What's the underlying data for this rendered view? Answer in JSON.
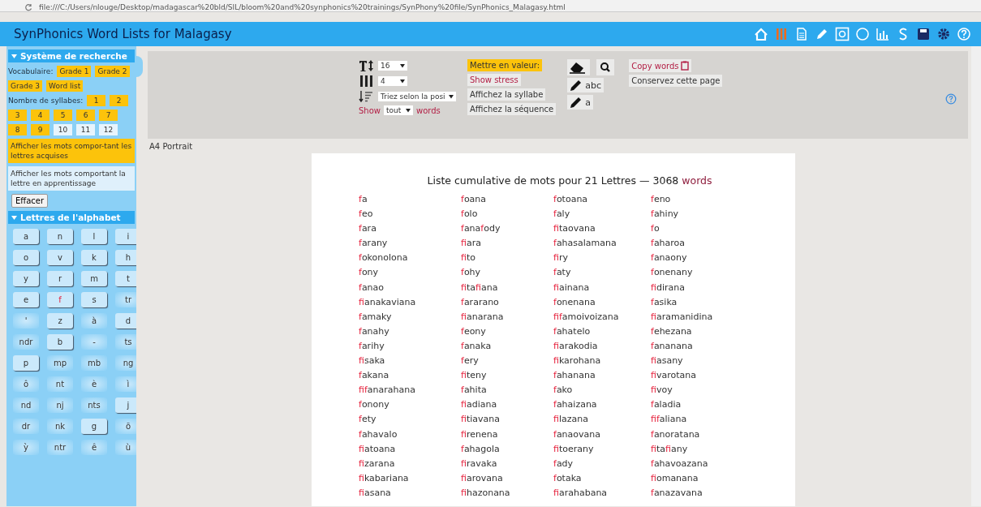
{
  "browser": {
    "url": "file:///C:/Users/nlouge/Desktop/madagascar%20bld/SIL/bloom%20and%20synphonics%20trainings/SynPhony%20file/SynPhonics_Malagasy.html"
  },
  "header": {
    "title": "SynPhonics Word Lists for Malagasy",
    "tools": [
      {
        "kind": "home",
        "selected": false
      },
      {
        "kind": "bars",
        "selected": true
      },
      {
        "kind": "doc",
        "selected": false
      },
      {
        "kind": "pencil",
        "selected": false
      },
      {
        "kind": "boxa",
        "selected": false
      },
      {
        "kind": "circle",
        "selected": false
      },
      {
        "kind": "chart",
        "selected": false
      },
      {
        "kind": "s",
        "selected": false
      },
      {
        "kind": "save",
        "selected": false
      },
      {
        "kind": "gear",
        "selected": false
      },
      {
        "kind": "help",
        "selected": false
      }
    ]
  },
  "sidebar": {
    "search": {
      "title": "Système de recherche",
      "expanded": true,
      "vocab_label": "Vocabulaire:",
      "vocab": [
        {
          "label": "Grade 1",
          "selected": true
        },
        {
          "label": "Grade 2",
          "selected": true
        },
        {
          "label": "Grade 3",
          "selected": true
        },
        {
          "label": "Word list",
          "selected": true
        }
      ],
      "syllables_label": "Nombre de syllabes:",
      "syllables": [
        {
          "label": "1",
          "selected": true
        },
        {
          "label": "2",
          "selected": true
        },
        {
          "label": "3",
          "selected": true
        },
        {
          "label": "4",
          "selected": true
        },
        {
          "label": "5",
          "selected": true
        },
        {
          "label": "6",
          "selected": true
        },
        {
          "label": "7",
          "selected": true
        },
        {
          "label": "8",
          "selected": true
        },
        {
          "label": "9",
          "selected": true
        },
        {
          "label": "10",
          "selected": false
        },
        {
          "label": "11",
          "selected": false
        },
        {
          "label": "12",
          "selected": false
        }
      ],
      "filters": [
        {
          "label": "Afficher les mots compor-tant les lettres acquises",
          "selected": true
        },
        {
          "label": "Afficher les mots comportant la lettre en apprentissage",
          "selected": false
        }
      ],
      "clear": "Effacer"
    },
    "alphabet": {
      "title": "Lettres de l'alphabet",
      "expanded": true,
      "letters": [
        {
          "label": "a",
          "acquired": true,
          "current": false
        },
        {
          "label": "n",
          "acquired": true,
          "current": false
        },
        {
          "label": "l",
          "acquired": true,
          "current": false
        },
        {
          "label": "i",
          "acquired": true,
          "current": false
        },
        {
          "label": "o",
          "acquired": true,
          "current": false
        },
        {
          "label": "v",
          "acquired": true,
          "current": false
        },
        {
          "label": "k",
          "acquired": true,
          "current": false
        },
        {
          "label": "h",
          "acquired": true,
          "current": false
        },
        {
          "label": "y",
          "acquired": true,
          "current": false
        },
        {
          "label": "r",
          "acquired": true,
          "current": false
        },
        {
          "label": "m",
          "acquired": true,
          "current": false
        },
        {
          "label": "t",
          "acquired": true,
          "current": false
        },
        {
          "label": "e",
          "acquired": true,
          "current": false
        },
        {
          "label": "f",
          "acquired": true,
          "current": true
        },
        {
          "label": "s",
          "acquired": true,
          "current": false
        },
        {
          "label": "tr",
          "acquired": false,
          "current": false
        },
        {
          "label": "'",
          "acquired": false,
          "current": false
        },
        {
          "label": "z",
          "acquired": true,
          "current": false
        },
        {
          "label": "à",
          "acquired": false,
          "current": false
        },
        {
          "label": "d",
          "acquired": true,
          "current": false
        },
        {
          "label": "ndr",
          "acquired": false,
          "current": false
        },
        {
          "label": "b",
          "acquired": true,
          "current": false
        },
        {
          "label": "-",
          "acquired": false,
          "current": false
        },
        {
          "label": "ts",
          "acquired": false,
          "current": false
        },
        {
          "label": "p",
          "acquired": true,
          "current": false
        },
        {
          "label": "mp",
          "acquired": false,
          "current": false
        },
        {
          "label": "mb",
          "acquired": false,
          "current": false
        },
        {
          "label": "ng",
          "acquired": false,
          "current": false
        },
        {
          "label": "ô",
          "acquired": false,
          "current": false
        },
        {
          "label": "nt",
          "acquired": false,
          "current": false
        },
        {
          "label": "è",
          "acquired": false,
          "current": false
        },
        {
          "label": "ì",
          "acquired": false,
          "current": false
        },
        {
          "label": "nd",
          "acquired": false,
          "current": false
        },
        {
          "label": "nj",
          "acquired": false,
          "current": false
        },
        {
          "label": "nts",
          "acquired": false,
          "current": false
        },
        {
          "label": "j",
          "acquired": true,
          "current": false
        },
        {
          "label": "dr",
          "acquired": false,
          "current": false
        },
        {
          "label": "nk",
          "acquired": false,
          "current": false
        },
        {
          "label": "g",
          "acquired": true,
          "current": false
        },
        {
          "label": "õ",
          "acquired": false,
          "current": false
        },
        {
          "label": "ỳ",
          "acquired": false,
          "current": false
        },
        {
          "label": "ntr",
          "acquired": false,
          "current": false
        },
        {
          "label": "ê",
          "acquired": false,
          "current": false
        },
        {
          "label": "ù",
          "acquired": false,
          "current": false
        }
      ]
    }
  },
  "toolbar": {
    "font_size": "16",
    "columns": "4",
    "sort": "Triez selon la posi",
    "show_label": "Show",
    "show_value": "tout",
    "show_suffix": "words",
    "options": [
      {
        "label": "Mettre en valeur:",
        "selected": true,
        "kind": "plain"
      },
      {
        "label": "Show stress",
        "selected": false,
        "kind": "stress"
      },
      {
        "label": "Affichez la syllabe",
        "selected": false,
        "kind": "plain"
      },
      {
        "label": "Affichez la séquence",
        "selected": false,
        "kind": "plain"
      }
    ],
    "pencil_labels": [
      "abc",
      "a"
    ],
    "copy": "Copy words",
    "keep": "Conservez cette page"
  },
  "page_format": "A4 Portrait",
  "list": {
    "title": "Liste cumulative de mots pour 21 Lettres — 3068",
    "title_suffix": "words",
    "rows": [
      [
        [
          {
            "hl": "f"
          },
          "a"
        ],
        [
          {
            "hl": "f"
          },
          "oana"
        ],
        [
          {
            "hl": "f"
          },
          "otoana"
        ],
        [
          {
            "hl": "f"
          },
          "eno"
        ]
      ],
      [
        [
          {
            "hl": "f"
          },
          "eo"
        ],
        [
          {
            "hl": "f"
          },
          "olo"
        ],
        [
          {
            "hl": "f"
          },
          "aly"
        ],
        [
          {
            "hl": "f"
          },
          "ahiny"
        ]
      ],
      [
        [
          {
            "hl": "f"
          },
          "ara"
        ],
        [
          {
            "hl": "f"
          },
          "ana",
          {
            "hl": "f"
          },
          "ody"
        ],
        [
          {
            "hl": "f"
          },
          "itaovana"
        ],
        [
          {
            "hl": "f"
          },
          "o"
        ]
      ],
      [
        [
          {
            "hl": "f"
          },
          "arany"
        ],
        [
          {
            "hl": "f"
          },
          "iara"
        ],
        [
          {
            "hl": "f"
          },
          "ahasalamana"
        ],
        [
          {
            "hl": "f"
          },
          "aharoa"
        ]
      ],
      [
        [
          {
            "hl": "f"
          },
          "okonolona"
        ],
        [
          {
            "hl": "f"
          },
          "ito"
        ],
        [
          {
            "hl": "f"
          },
          "iry"
        ],
        [
          {
            "hl": "f"
          },
          "anaony"
        ]
      ],
      [
        [
          {
            "hl": "f"
          },
          "ony"
        ],
        [
          {
            "hl": "f"
          },
          "ohy"
        ],
        [
          {
            "hl": "f"
          },
          "aty"
        ],
        [
          {
            "hl": "f"
          },
          "onenany"
        ]
      ],
      [
        [
          {
            "hl": "f"
          },
          "anao"
        ],
        [
          {
            "hl": "f"
          },
          "ita",
          {
            "hl": "f"
          },
          "iana"
        ],
        [
          {
            "hl": "f"
          },
          "iainana"
        ],
        [
          {
            "hl": "f"
          },
          "idirana"
        ]
      ],
      [
        [
          {
            "hl": "f"
          },
          "ianakaviana"
        ],
        [
          {
            "hl": "f"
          },
          "ararano"
        ],
        [
          {
            "hl": "f"
          },
          "onenana"
        ],
        [
          {
            "hl": "f"
          },
          "asika"
        ]
      ],
      [
        [
          {
            "hl": "f"
          },
          "amaky"
        ],
        [
          {
            "hl": "f"
          },
          "ianarana"
        ],
        [
          {
            "hl": "f"
          },
          "i",
          {
            "hl": "f"
          },
          "amoivoizana"
        ],
        [
          {
            "hl": "f"
          },
          "iaramanidina"
        ]
      ],
      [
        [
          {
            "hl": "f"
          },
          "anahy"
        ],
        [
          {
            "hl": "f"
          },
          "eony"
        ],
        [
          {
            "hl": "f"
          },
          "ahatelo"
        ],
        [
          {
            "hl": "f"
          },
          "ehezana"
        ]
      ],
      [
        [
          {
            "hl": "f"
          },
          "arihy"
        ],
        [
          {
            "hl": "f"
          },
          "anaka"
        ],
        [
          {
            "hl": "f"
          },
          "iarakodia"
        ],
        [
          {
            "hl": "f"
          },
          "ananana"
        ]
      ],
      [
        [
          {
            "hl": "f"
          },
          "isaka"
        ],
        [
          {
            "hl": "f"
          },
          "ery"
        ],
        [
          {
            "hl": "f"
          },
          "ikarohana"
        ],
        [
          {
            "hl": "f"
          },
          "iasany"
        ]
      ],
      [
        [
          {
            "hl": "f"
          },
          "akana"
        ],
        [
          {
            "hl": "f"
          },
          "iteny"
        ],
        [
          {
            "hl": "f"
          },
          "ahanana"
        ],
        [
          {
            "hl": "f"
          },
          "ivarotana"
        ]
      ],
      [
        [
          {
            "hl": "f"
          },
          "i",
          {
            "hl": "f"
          },
          "anarahana"
        ],
        [
          {
            "hl": "f"
          },
          "ahita"
        ],
        [
          {
            "hl": "f"
          },
          "ako"
        ],
        [
          {
            "hl": "f"
          },
          "ivoy"
        ]
      ],
      [
        [
          {
            "hl": "f"
          },
          "onony"
        ],
        [
          {
            "hl": "f"
          },
          "iadiana"
        ],
        [
          {
            "hl": "f"
          },
          "ahaizana"
        ],
        [
          {
            "hl": "f"
          },
          "aladia"
        ]
      ],
      [
        [
          {
            "hl": "f"
          },
          "ety"
        ],
        [
          {
            "hl": "f"
          },
          "itiavana"
        ],
        [
          {
            "hl": "f"
          },
          "ilazana"
        ],
        [
          {
            "hl": "f"
          },
          "i",
          {
            "hl": "f"
          },
          "aliana"
        ]
      ],
      [
        [
          {
            "hl": "f"
          },
          "ahavalo"
        ],
        [
          {
            "hl": "f"
          },
          "irenena"
        ],
        [
          {
            "hl": "f"
          },
          "anaovana"
        ],
        [
          {
            "hl": "f"
          },
          "anoratana"
        ]
      ],
      [
        [
          {
            "hl": "f"
          },
          "iatoana"
        ],
        [
          {
            "hl": "f"
          },
          "ahagola"
        ],
        [
          {
            "hl": "f"
          },
          "itoerany"
        ],
        [
          {
            "hl": "f"
          },
          "ita",
          {
            "hl": "f"
          },
          "iany"
        ]
      ],
      [
        [
          {
            "hl": "f"
          },
          "izarana"
        ],
        [
          {
            "hl": "f"
          },
          "iravaka"
        ],
        [
          {
            "hl": "f"
          },
          "ady"
        ],
        [
          {
            "hl": "f"
          },
          "ahavoazana"
        ]
      ],
      [
        [
          {
            "hl": "f"
          },
          "ikabariana"
        ],
        [
          {
            "hl": "f"
          },
          "iarovana"
        ],
        [
          {
            "hl": "f"
          },
          "otaka"
        ],
        [
          {
            "hl": "f"
          },
          "iomanana"
        ]
      ],
      [
        [
          {
            "hl": "f"
          },
          "iasana"
        ],
        [
          {
            "hl": "f"
          },
          "ihazonana"
        ],
        [
          {
            "hl": "f"
          },
          "iarahabana"
        ],
        [
          {
            "hl": "f"
          },
          "anazavana"
        ]
      ]
    ]
  }
}
